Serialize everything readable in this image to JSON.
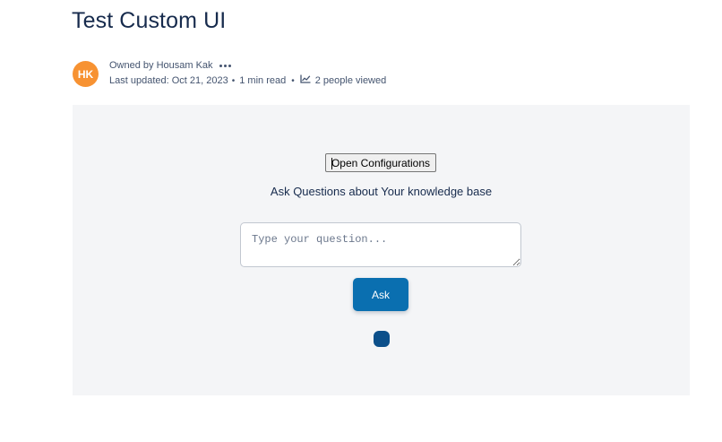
{
  "page": {
    "title": "Test Custom UI"
  },
  "byline": {
    "avatar_initials": "HK",
    "owner_text": "Owned by Housam Kak",
    "last_updated": "Last updated: Oct 21, 2023",
    "read_time": "1 min read",
    "views": "2 people viewed"
  },
  "panel": {
    "config_button_label": "Open Configurations",
    "subtitle": "Ask Questions about Your knowledge base",
    "question_placeholder": "Type your question...",
    "question_value": "",
    "ask_button_label": "Ask"
  },
  "icons": {
    "more": "more-horizontal-icon",
    "views": "chart-line-icon",
    "loader": "loading-spinner-icon"
  },
  "colors": {
    "avatar": "#f79232",
    "panel_background": "#f4f5f7",
    "ask_button": "#0a6fb0",
    "spinner": "#0b4f8a",
    "title_text": "#172b4d"
  }
}
